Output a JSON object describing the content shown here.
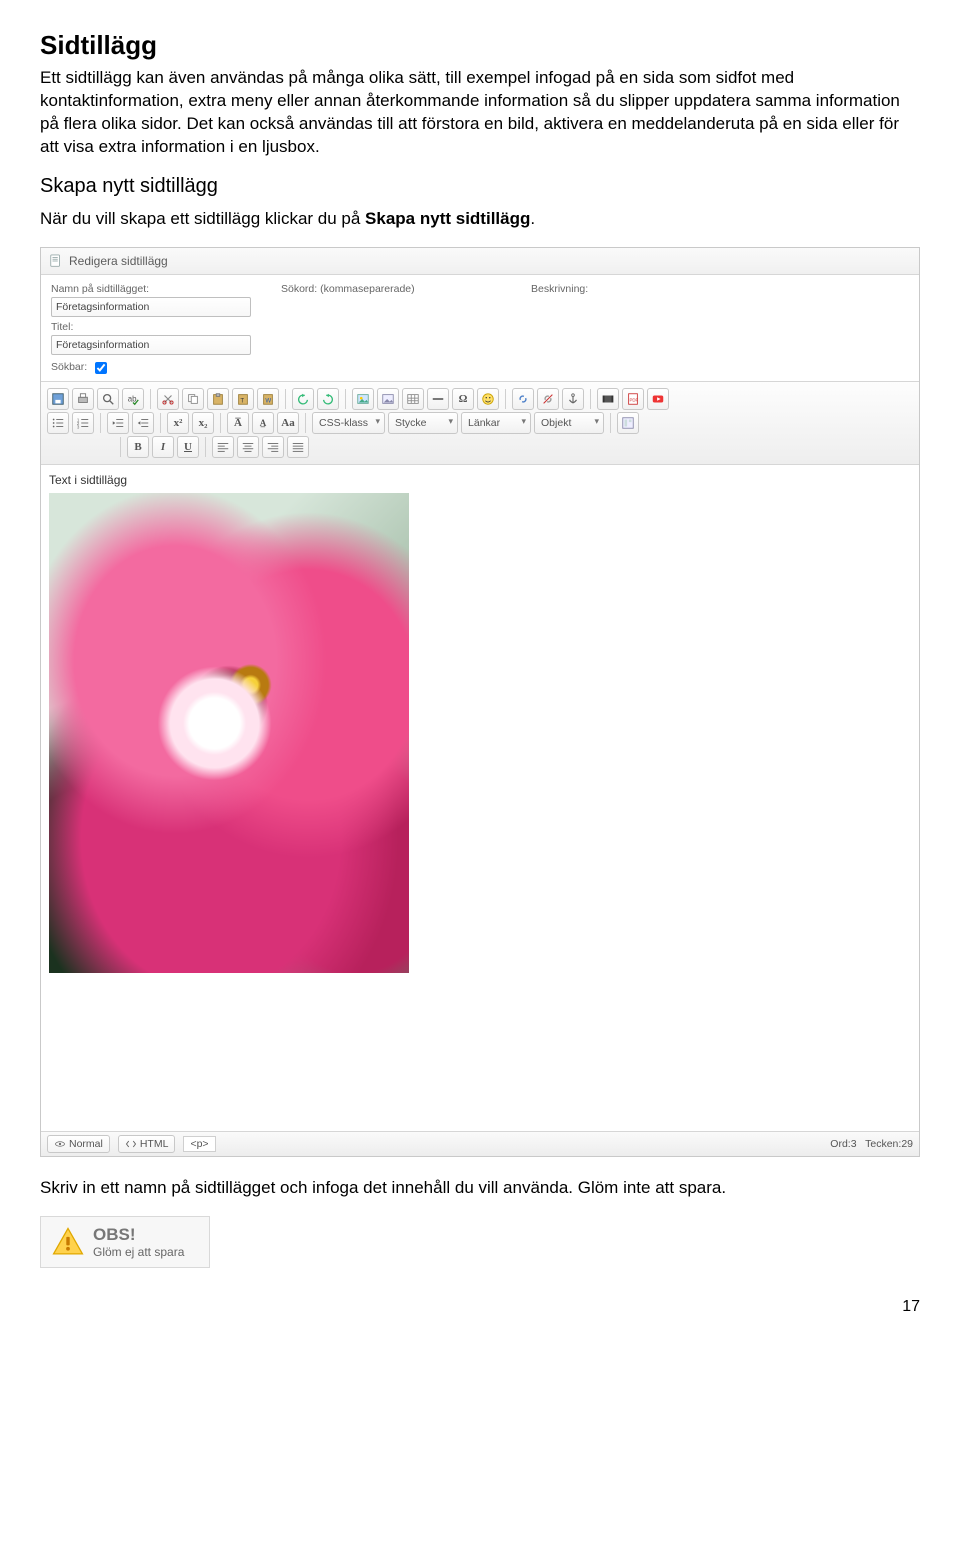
{
  "heading": "Sidtillägg",
  "intro": "Ett sidtillägg kan även användas på många olika sätt, till exempel infogad på en sida som sidfot med kontaktinformation, extra meny eller annan återkommande information så du slipper uppdatera samma information på flera olika sidor. Det kan också användas till att förstora en bild, aktivera en meddelanderuta på en sida eller för att visa extra information i en ljusbox.",
  "sub1": "Skapa nytt sidtillägg",
  "sub1_text_pre": "När du vill skapa ett sidtillägg klickar du på ",
  "sub1_text_bold": "Skapa nytt sidtillägg",
  "sub1_text_post": ".",
  "panel": {
    "title": "Redigera sidtillägg",
    "labels": {
      "name": "Namn på sidtillägget:",
      "keywords": "Sökord: (kommaseparerade)",
      "desc": "Beskrivning:",
      "title": "Titel:",
      "searchable": "Sökbar:"
    },
    "values": {
      "name": "Företagsinformation",
      "title_field": "Företagsinformation",
      "searchable": true
    },
    "dropdowns": {
      "css": "CSS-klass",
      "block": "Stycke",
      "links": "Länkar",
      "objects": "Objekt"
    },
    "editor_label": "Text i sidtillägg",
    "status": {
      "normal": "Normal",
      "html": "HTML",
      "tag": "<p>",
      "words_label": "Ord:",
      "words": "3",
      "chars_label": "Tecken:",
      "chars": "29"
    }
  },
  "after_panel": "Skriv in ett namn på sidtillägget och infoga det innehåll du vill använda. Glöm inte att spara.",
  "obs": {
    "title": "OBS!",
    "text": "Glöm ej att spara"
  },
  "pagenum": "17"
}
